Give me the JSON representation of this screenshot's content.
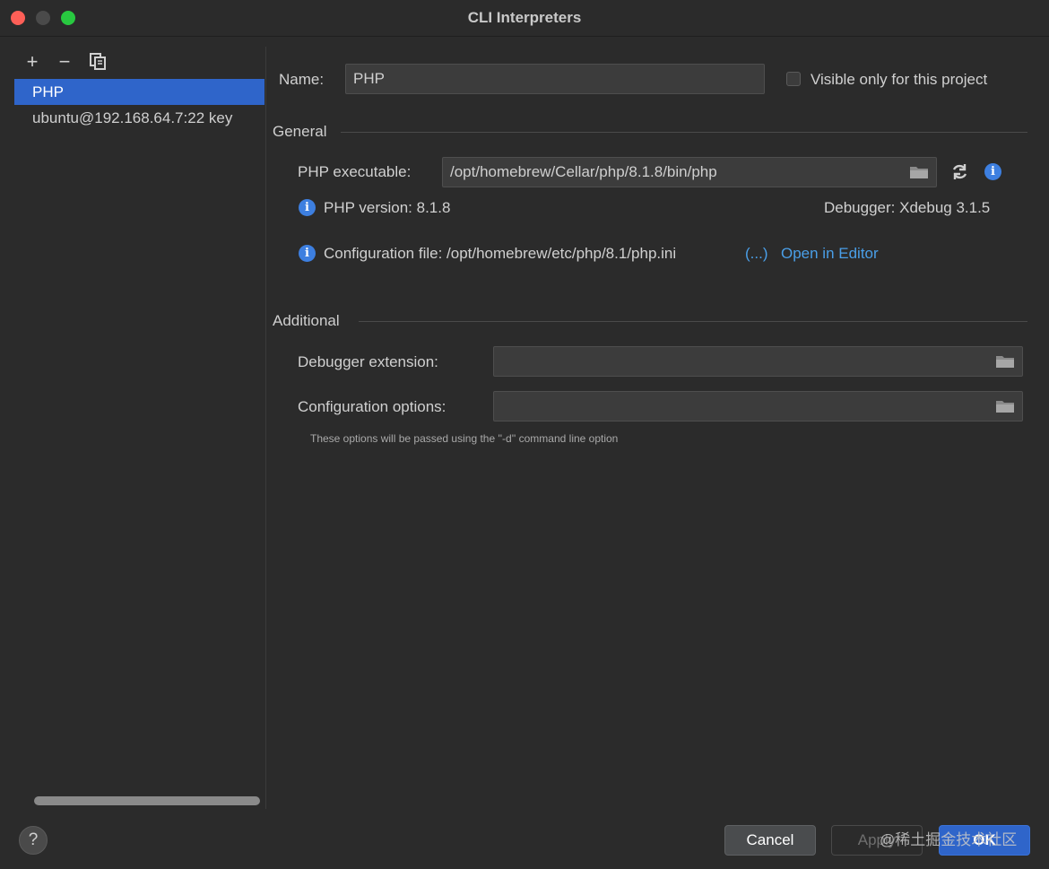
{
  "window": {
    "title": "CLI Interpreters"
  },
  "toolbar": {
    "add": "+",
    "remove": "−"
  },
  "interpreters": [
    {
      "label": "PHP",
      "selected": true
    },
    {
      "label": "ubuntu@192.168.64.7:22 key",
      "selected": false
    }
  ],
  "form": {
    "name_label": "Name:",
    "name_value": "PHP",
    "visible_only_label": "Visible only for this project",
    "general_title": "General",
    "php_exec_label": "PHP executable:",
    "php_exec_value": "/opt/homebrew/Cellar/php/8.1.8/bin/php",
    "php_version": "PHP version: 8.1.8",
    "debugger": "Debugger: Xdebug 3.1.5",
    "config_file": "Configuration file: /opt/homebrew/etc/php/8.1/php.ini",
    "config_more": "(...)",
    "open_in_editor": "Open in Editor",
    "additional_title": "Additional",
    "debugger_ext_label": "Debugger extension:",
    "debugger_ext_value": "",
    "config_opts_label": "Configuration options:",
    "config_opts_value": "",
    "config_opts_hint": "These options will be passed using the ''-d'' command line option"
  },
  "buttons": {
    "help": "?",
    "cancel": "Cancel",
    "apply": "Apply",
    "ok": "OK"
  },
  "watermark": "@稀土掘金技术社区",
  "colors": {
    "accent": "#2f65ca",
    "link": "#4a9fe8",
    "info": "#3d7fe0"
  }
}
